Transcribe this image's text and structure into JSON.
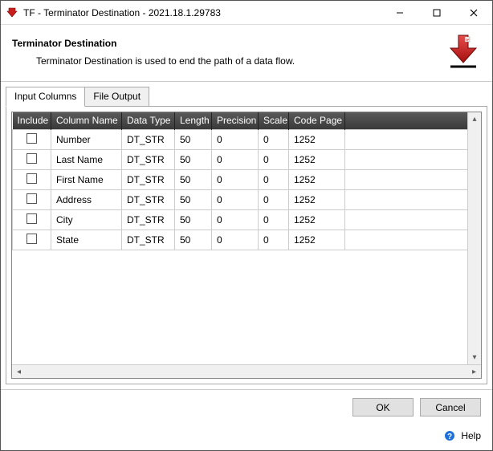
{
  "window": {
    "title": "TF - Terminator Destination - 2021.18.1.29783"
  },
  "header": {
    "title": "Terminator Destination",
    "description": "Terminator Destination is used to end the path of a data flow."
  },
  "tabs": [
    {
      "label": "Input Columns",
      "active": true
    },
    {
      "label": "File Output",
      "active": false
    }
  ],
  "grid": {
    "columns": [
      "Include",
      "Column Name",
      "Data Type",
      "Length",
      "Precision",
      "Scale",
      "Code Page"
    ],
    "rows": [
      {
        "include": false,
        "name": "Number",
        "dtype": "DT_STR",
        "length": "50",
        "precision": "0",
        "scale": "0",
        "codepage": "1252"
      },
      {
        "include": false,
        "name": "Last Name",
        "dtype": "DT_STR",
        "length": "50",
        "precision": "0",
        "scale": "0",
        "codepage": "1252"
      },
      {
        "include": false,
        "name": "First Name",
        "dtype": "DT_STR",
        "length": "50",
        "precision": "0",
        "scale": "0",
        "codepage": "1252"
      },
      {
        "include": false,
        "name": "Address",
        "dtype": "DT_STR",
        "length": "50",
        "precision": "0",
        "scale": "0",
        "codepage": "1252"
      },
      {
        "include": false,
        "name": "City",
        "dtype": "DT_STR",
        "length": "50",
        "precision": "0",
        "scale": "0",
        "codepage": "1252"
      },
      {
        "include": false,
        "name": "State",
        "dtype": "DT_STR",
        "length": "50",
        "precision": "0",
        "scale": "0",
        "codepage": "1252"
      }
    ]
  },
  "buttons": {
    "ok": "OK",
    "cancel": "Cancel",
    "help": "Help"
  }
}
